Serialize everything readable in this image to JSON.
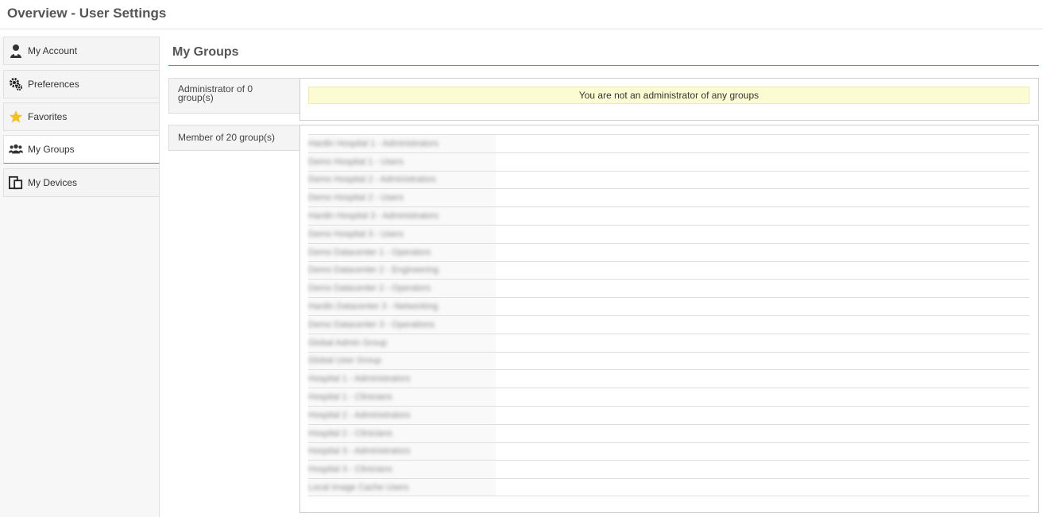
{
  "header": {
    "title": "Overview - User Settings"
  },
  "sidebar": {
    "items": [
      {
        "label": "My Account",
        "icon": "user-icon"
      },
      {
        "label": "Preferences",
        "icon": "gear-icon"
      },
      {
        "label": "Favorites",
        "icon": "star-icon"
      },
      {
        "label": "My Groups",
        "icon": "group-icon",
        "active": true
      },
      {
        "label": "My Devices",
        "icon": "devices-icon"
      }
    ]
  },
  "main": {
    "title": "My Groups",
    "admin": {
      "label": "Administrator of 0 group(s)",
      "notice": "You are not an administrator of any groups"
    },
    "member": {
      "label": "Member of 20 group(s)",
      "groups": [
        "Hardin Hospital 1 - Administrators",
        "Demo Hospital 1 - Users",
        "Demo Hospital 2 - Administrators",
        "Demo Hospital 2 - Users",
        "Hardin Hospital 3 - Administrators",
        "Demo Hospital 3 - Users",
        "Demo Datacenter 1 - Operators",
        "Demo Datacenter 2 - Engineering",
        "Demo Datacenter 2 - Operators",
        "Hardin Datacenter 3 - Networking",
        "Demo Datacenter 3 - Operations",
        "Global Admin Group",
        "Global User Group",
        "Hospital 1 - Administrators",
        "Hospital 1 - Clinicians",
        "Hospital 2 - Administrators",
        "Hospital 2 - Clinicians",
        "Hospital 3 - Administrators",
        "Hospital 3 - Clinicians",
        "Local Image Cache Users"
      ]
    }
  },
  "colors": {
    "accent": "#3aa5a5",
    "notice_bg": "#fcfcd3"
  }
}
